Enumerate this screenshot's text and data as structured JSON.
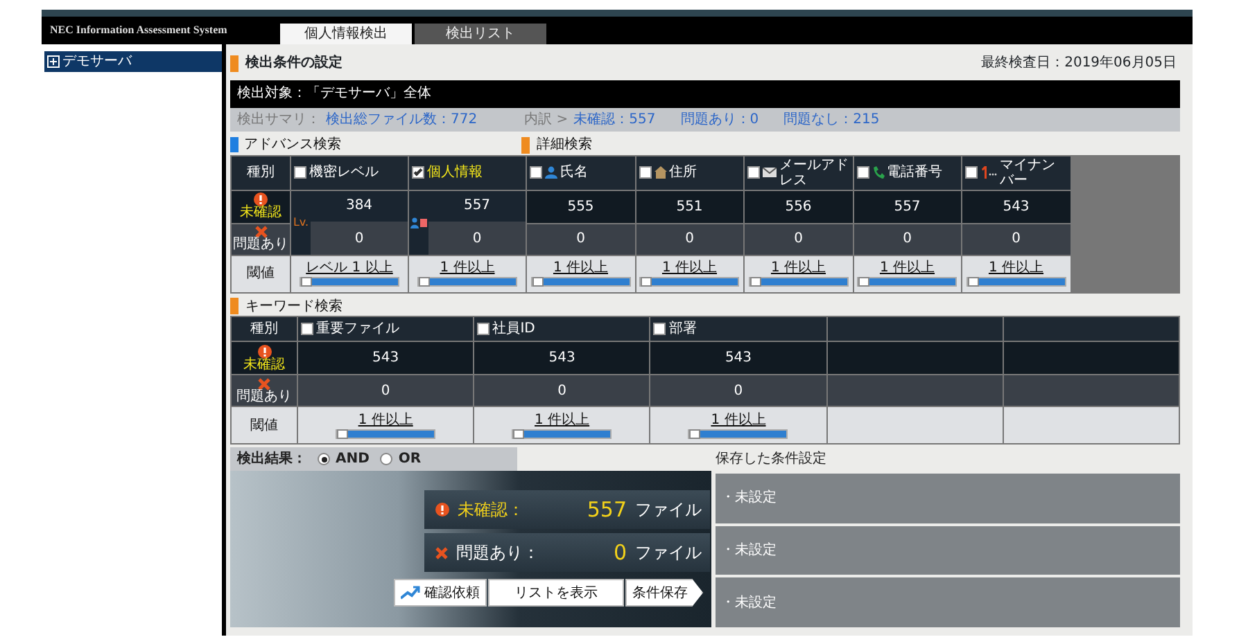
{
  "header": {
    "app_title": "NEC Information Assessment System",
    "tabs": [
      {
        "label": "個人情報検出",
        "selected": true
      },
      {
        "label": "検出リスト",
        "selected": false
      }
    ]
  },
  "sidebar": {
    "items": [
      {
        "label": "デモサーバ",
        "selected": true,
        "expanded": false
      }
    ]
  },
  "page_title": "検出条件の設定",
  "last_checked": "最終検査日：2019年06月05日",
  "target": "検出対象：「デモサーバ」全体",
  "summary": {
    "label": "検出サマリ：",
    "total": "検出総ファイル数：772",
    "breakdown_label": "内訳 >",
    "items": [
      "未確認：557",
      "問題あり：0",
      "問題なし：215"
    ]
  },
  "advanced_search": {
    "title": "アドバンス検索"
  },
  "detail_search": {
    "title": "詳細検索"
  },
  "detection_table": {
    "row_labels": [
      "種別",
      "未確認",
      "問題あり",
      "閾値"
    ],
    "columns": [
      {
        "kind": "level",
        "label": "機密レベル",
        "checked": false,
        "marker": "Lv.",
        "unconfirmed": "384",
        "problems": "0",
        "threshold": "レベル 1 以上",
        "level": 0
      },
      {
        "kind": "personal",
        "label": "個人情報",
        "checked": true,
        "unconfirmed": "557",
        "problems": "0",
        "threshold": "1 件以上",
        "level": 0
      },
      {
        "kind": "name",
        "label": "氏名",
        "checked": false,
        "unconfirmed": "555",
        "problems": "0",
        "threshold": "1 件以上",
        "level": 0
      },
      {
        "kind": "address",
        "label": "住所",
        "checked": false,
        "unconfirmed": "551",
        "problems": "0",
        "threshold": "1 件以上",
        "level": 0
      },
      {
        "kind": "email",
        "label": "メールアドレス",
        "checked": false,
        "unconfirmed": "556",
        "problems": "0",
        "threshold": "1 件以上",
        "level": 0
      },
      {
        "kind": "phone",
        "label": "電話番号",
        "checked": false,
        "unconfirmed": "557",
        "problems": "0",
        "threshold": "1 件以上",
        "level": 0
      },
      {
        "kind": "my_number",
        "label": "マイナンバー",
        "checked": false,
        "unconfirmed": "543",
        "problems": "0",
        "threshold": "1 件以上",
        "level": 0
      }
    ]
  },
  "keyword_search": {
    "title": "キーワード検索",
    "row_labels": [
      "種別",
      "未確認",
      "問題あり",
      "閾値"
    ],
    "columns": [
      {
        "label": "重要ファイル",
        "checked": false,
        "unconfirmed": "543",
        "problems": "0",
        "threshold": "1 件以上",
        "level": 0
      },
      {
        "label": "社員ID",
        "checked": false,
        "unconfirmed": "543",
        "problems": "0",
        "threshold": "1 件以上",
        "level": 0
      },
      {
        "label": "部署",
        "checked": false,
        "unconfirmed": "543",
        "problems": "0",
        "threshold": "1 件以上",
        "level": 0
      }
    ]
  },
  "result": {
    "label": "検出結果：",
    "options": [
      {
        "label": "AND",
        "selected": true
      },
      {
        "label": "OR",
        "selected": false
      }
    ]
  },
  "result_panel": {
    "unconfirmed_label": "未確認：",
    "unconfirmed_count": "557",
    "problems_label": "問題あり：",
    "problems_count": "0",
    "unit": [
      "ファイル",
      "ファイル"
    ],
    "buttons": [
      {
        "kind": "request",
        "label": "確認依頼"
      },
      {
        "kind": "plain",
        "label": "リストを表示"
      },
      {
        "kind": "save",
        "label": "条件保存"
      }
    ]
  },
  "saved_conditions": {
    "title": "保存した条件設定",
    "items": [
      "・未設定",
      "・未設定",
      "・未設定"
    ]
  }
}
